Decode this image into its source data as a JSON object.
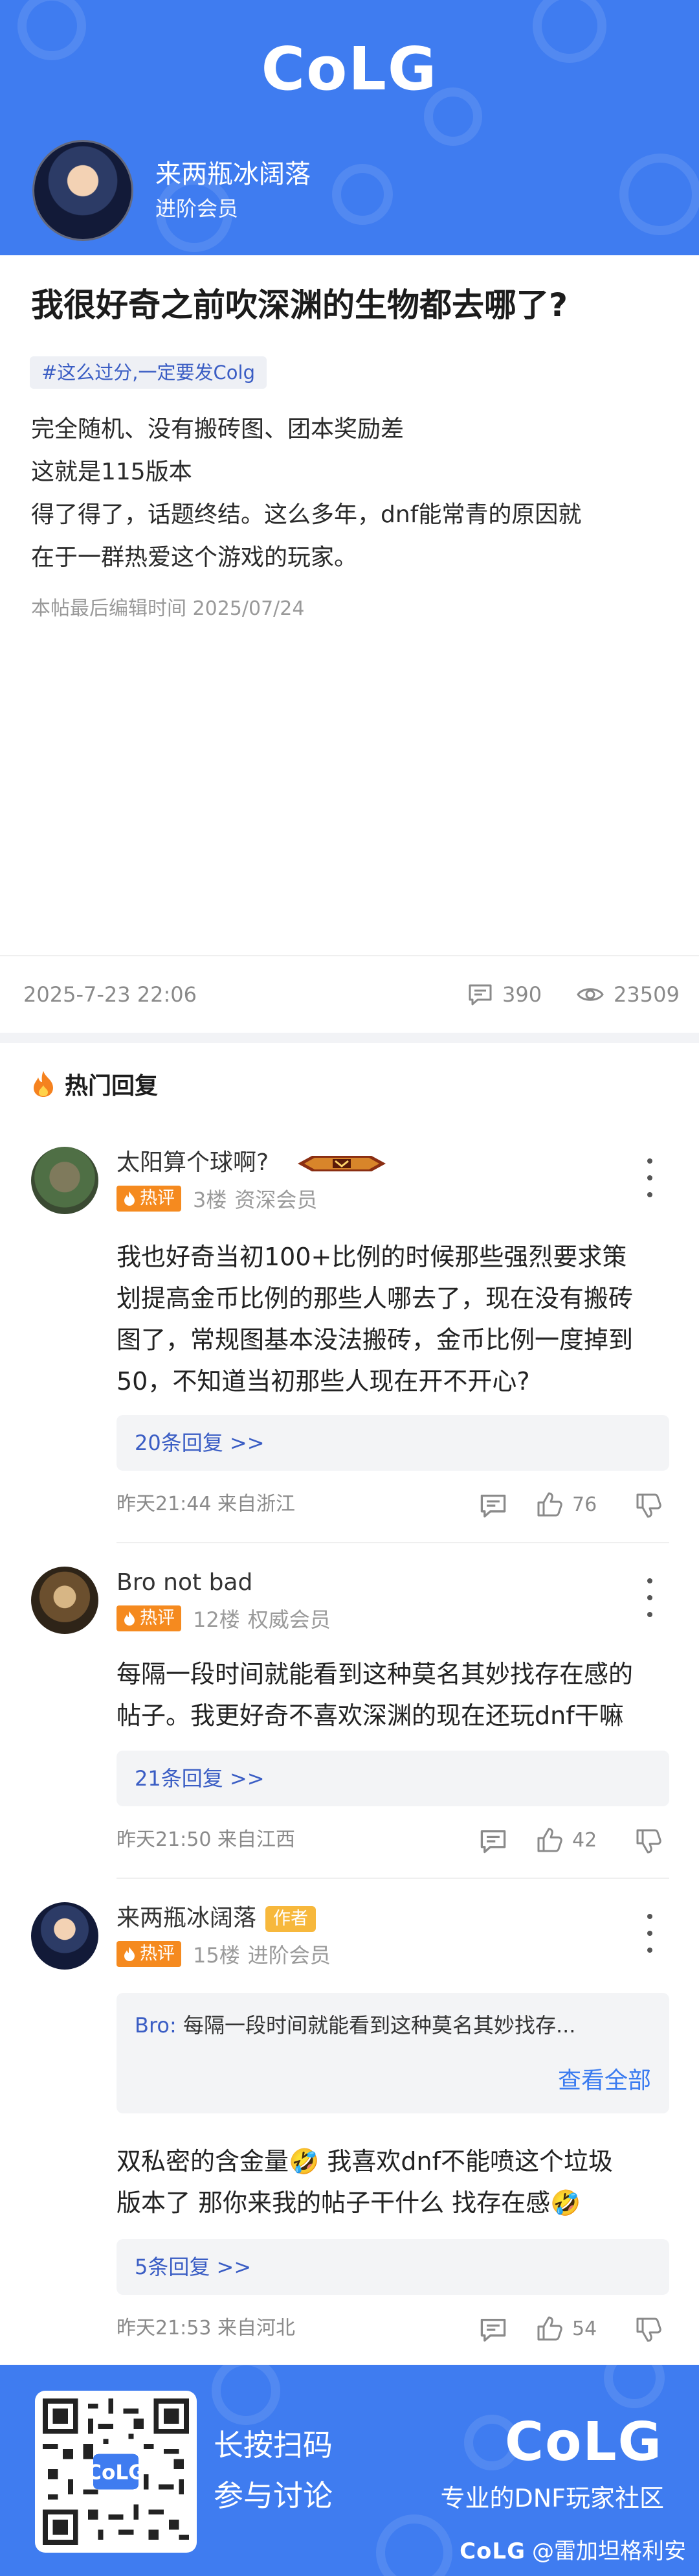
{
  "header": {
    "logo_text": "CoLG",
    "author": {
      "name": "来两瓶冰阔落",
      "level": "进阶会员"
    }
  },
  "post": {
    "title": "我很好奇之前吹深渊的生物都去哪了?",
    "tag": "#这么过分,一定要发Colg",
    "body": [
      "完全随机、没有搬砖图、团本奖励差",
      "这就是115版本",
      "得了得了，话题终结。这么多年，dnf能常青的原因就",
      "在于一群热爱这个游戏的玩家。"
    ],
    "edit_note": "本帖最后编辑时间 2025/07/24",
    "date": "2025-7-23 22:06",
    "comment_count": "390",
    "view_count": "23509"
  },
  "hot_replies": {
    "title": "热门回复",
    "items": [
      {
        "name": "太阳算个球啊?",
        "badge": "热评",
        "floor": "3楼",
        "member": "资深会员",
        "text": [
          "我也好奇当初100+比例的时候那些强烈要求策",
          "划提高金币比例的那些人哪去了，现在没有搬砖",
          "图了，常规图基本没法搬砖，金币比例一度掉到",
          "50，不知道当初那些人现在开不开心?"
        ],
        "sub_replies": "20条回复 >>",
        "time": "昨天21:44 来自浙江",
        "likes": "76"
      },
      {
        "name": "Bro not bad",
        "badge": "热评",
        "floor": "12楼",
        "member": "权威会员",
        "text": [
          "每隔一段时间就能看到这种莫名其妙找存在感的",
          "帖子。我更好奇不喜欢深渊的现在还玩dnf干嘛"
        ],
        "sub_replies": "21条回复 >>",
        "time": "昨天21:50 来自江西",
        "likes": "42"
      },
      {
        "name": "来两瓶冰阔落",
        "author_tag": "作者",
        "badge": "热评",
        "floor": "15楼",
        "member": "进阶会员",
        "quote_from": "Bro:",
        "quote_text": "每隔一段时间就能看到这种莫名其妙找存...",
        "quote_all": "查看全部",
        "text": [
          "双私密的含金量🤣 我喜欢dnf不能喷这个垃圾",
          "版本了 那你来我的帖子干什么 找存在感🤣"
        ],
        "sub_replies": "5条回复 >>",
        "time": "昨天21:53 来自河北",
        "likes": "54"
      }
    ]
  },
  "footer": {
    "cta_line1": "长按扫码",
    "cta_line2": "参与讨论",
    "logo_text": "CoLG",
    "slogan": "专业的DNF玩家社区",
    "credit_logo": "CoLG",
    "credit_user": "@雷加坦格利安"
  },
  "icons": {
    "comment": "comment-icon",
    "view": "eye-icon",
    "fire": "fire-icon",
    "like": "thumbs-up-icon",
    "dislike": "thumbs-down-icon",
    "more": "more-vertical-icon",
    "qr": "qr-code-icon"
  },
  "colors": {
    "brand_blue": "#3f7cf0",
    "hot_badge": "#f58a1f",
    "author_tag": "#f7b83c",
    "link_blue": "#3a5dc4"
  }
}
